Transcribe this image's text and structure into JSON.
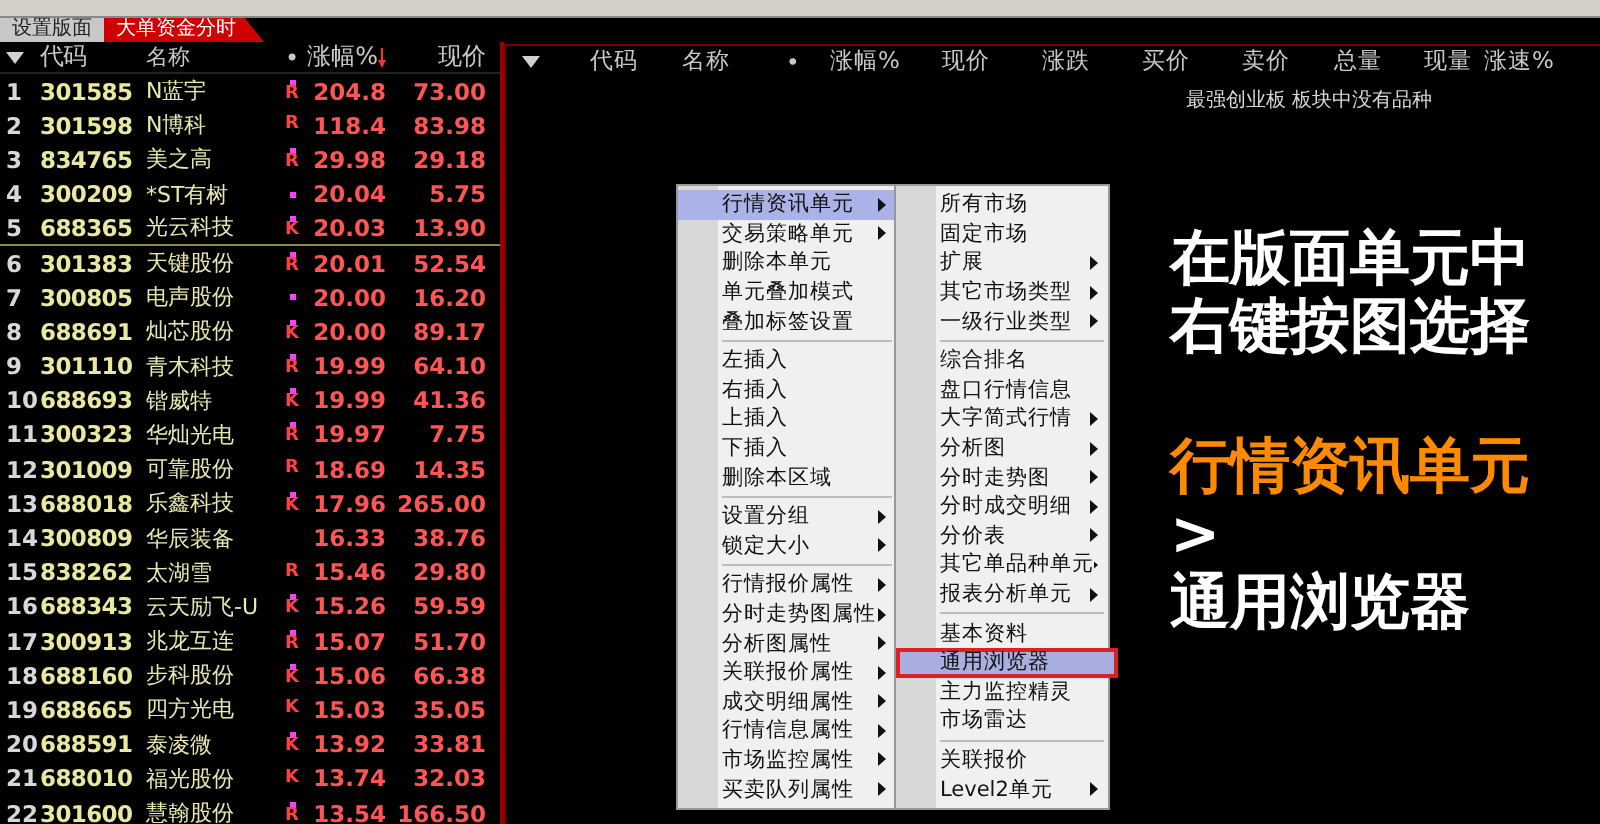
{
  "top_tabs": [
    {
      "label": "设置版面",
      "selected": false
    },
    {
      "label": "大单资金分时",
      "selected": true
    }
  ],
  "left_table": {
    "columns": [
      {
        "label": "代码",
        "sorted": false
      },
      {
        "label": "名称",
        "sorted": false
      },
      {
        "label": "•",
        "sorted": false
      },
      {
        "label": "涨幅%",
        "sorted": true
      },
      {
        "label": "现价",
        "sorted": false
      }
    ],
    "rows": [
      {
        "no": "1",
        "code": "301585",
        "name": "N蓝宇",
        "flag": true,
        "tag": "R",
        "change": "204.8",
        "price": "73.00",
        "separator_below": false
      },
      {
        "no": "2",
        "code": "301598",
        "name": "N博科",
        "flag": false,
        "tag": "R",
        "change": "118.4",
        "price": "83.98",
        "separator_below": false
      },
      {
        "no": "3",
        "code": "834765",
        "name": "美之高",
        "flag": true,
        "tag": "R",
        "change": "29.98",
        "price": "29.18",
        "separator_below": false
      },
      {
        "no": "4",
        "code": "300209",
        "name": "*ST有树",
        "flag": true,
        "tag": "",
        "change": "20.04",
        "price": "5.75",
        "separator_below": false
      },
      {
        "no": "5",
        "code": "688365",
        "name": "光云科技",
        "flag": true,
        "tag": "K",
        "change": "20.03",
        "price": "13.90",
        "separator_below": true
      },
      {
        "no": "6",
        "code": "301383",
        "name": "天键股份",
        "flag": true,
        "tag": "R",
        "change": "20.01",
        "price": "52.54",
        "separator_below": false
      },
      {
        "no": "7",
        "code": "300805",
        "name": "电声股份",
        "flag": true,
        "tag": "",
        "change": "20.00",
        "price": "16.20",
        "separator_below": false
      },
      {
        "no": "8",
        "code": "688691",
        "name": "灿芯股份",
        "flag": true,
        "tag": "K",
        "change": "20.00",
        "price": "89.17",
        "separator_below": false
      },
      {
        "no": "9",
        "code": "301110",
        "name": "青木科技",
        "flag": true,
        "tag": "R",
        "change": "19.99",
        "price": "64.10",
        "separator_below": false
      },
      {
        "no": "10",
        "code": "688693",
        "name": "锴威特",
        "flag": true,
        "tag": "K",
        "change": "19.99",
        "price": "41.36",
        "separator_below": false
      },
      {
        "no": "11",
        "code": "300323",
        "name": "华灿光电",
        "flag": true,
        "tag": "R",
        "change": "19.97",
        "price": "7.75",
        "separator_below": false
      },
      {
        "no": "12",
        "code": "301009",
        "name": "可靠股份",
        "flag": false,
        "tag": "R",
        "change": "18.69",
        "price": "14.35",
        "separator_below": false
      },
      {
        "no": "13",
        "code": "688018",
        "name": "乐鑫科技",
        "flag": true,
        "tag": "K",
        "change": "17.96",
        "price": "265.00",
        "separator_below": false
      },
      {
        "no": "14",
        "code": "300809",
        "name": "华辰装备",
        "flag": false,
        "tag": "",
        "change": "16.33",
        "price": "38.76",
        "separator_below": false
      },
      {
        "no": "15",
        "code": "838262",
        "name": "太湖雪",
        "flag": false,
        "tag": "R",
        "change": "15.46",
        "price": "29.80",
        "separator_below": false
      },
      {
        "no": "16",
        "code": "688343",
        "name": "云天励飞-U",
        "flag": true,
        "tag": "K",
        "change": "15.26",
        "price": "59.59",
        "separator_below": false
      },
      {
        "no": "17",
        "code": "300913",
        "name": "兆龙互连",
        "flag": true,
        "tag": "R",
        "change": "15.07",
        "price": "51.70",
        "separator_below": false
      },
      {
        "no": "18",
        "code": "688160",
        "name": "步科股份",
        "flag": true,
        "tag": "K",
        "change": "15.06",
        "price": "66.38",
        "separator_below": false
      },
      {
        "no": "19",
        "code": "688665",
        "name": "四方光电",
        "flag": false,
        "tag": "K",
        "change": "15.03",
        "price": "35.05",
        "separator_below": false
      },
      {
        "no": "20",
        "code": "688591",
        "name": "泰凌微",
        "flag": true,
        "tag": "K",
        "change": "13.92",
        "price": "33.81",
        "separator_below": false
      },
      {
        "no": "21",
        "code": "688010",
        "name": "福光股份",
        "flag": false,
        "tag": "K",
        "change": "13.74",
        "price": "32.03",
        "separator_below": false
      },
      {
        "no": "22",
        "code": "301600",
        "name": "慧翰股份",
        "flag": true,
        "tag": "R",
        "change": "13.54",
        "price": "166.50",
        "separator_below": false
      }
    ]
  },
  "right_table": {
    "columns": [
      {
        "label": "代码"
      },
      {
        "label": "名称"
      },
      {
        "label": "•"
      },
      {
        "label": "涨幅%"
      },
      {
        "label": "现价"
      },
      {
        "label": "涨跌"
      },
      {
        "label": "买价"
      },
      {
        "label": "卖价"
      },
      {
        "label": "总量"
      },
      {
        "label": "现量"
      },
      {
        "label": "涨速%"
      }
    ],
    "message": "最强创业板 板块中没有品种"
  },
  "annotation": [
    {
      "text": "在版面单元中",
      "color": "#ffffff"
    },
    {
      "text": "右键按图选择",
      "color": "#ffffff"
    },
    {
      "text": "行情资讯单元",
      "color": "#ff8a00"
    },
    {
      "text": ">",
      "color": "#ffffff"
    },
    {
      "text": "通用浏览器",
      "color": "#ffffff"
    }
  ],
  "context_menu": {
    "items": [
      {
        "kind": "item",
        "label": "行情资讯单元",
        "has_submenu": true,
        "selected": true
      },
      {
        "kind": "item",
        "label": "交易策略单元",
        "has_submenu": true,
        "selected": false
      },
      {
        "kind": "item",
        "label": "删除本单元",
        "has_submenu": false,
        "selected": false
      },
      {
        "kind": "item",
        "label": "单元叠加模式",
        "has_submenu": false,
        "selected": false
      },
      {
        "kind": "item",
        "label": "叠加标签设置",
        "has_submenu": false,
        "selected": false
      },
      {
        "kind": "separator"
      },
      {
        "kind": "item",
        "label": "左插入",
        "has_submenu": false,
        "selected": false
      },
      {
        "kind": "item",
        "label": "右插入",
        "has_submenu": false,
        "selected": false
      },
      {
        "kind": "item",
        "label": "上插入",
        "has_submenu": false,
        "selected": false
      },
      {
        "kind": "item",
        "label": "下插入",
        "has_submenu": false,
        "selected": false
      },
      {
        "kind": "item",
        "label": "删除本区域",
        "has_submenu": false,
        "selected": false
      },
      {
        "kind": "separator"
      },
      {
        "kind": "item",
        "label": "设置分组",
        "has_submenu": true,
        "selected": false
      },
      {
        "kind": "item",
        "label": "锁定大小",
        "has_submenu": true,
        "selected": false
      },
      {
        "kind": "separator"
      },
      {
        "kind": "item",
        "label": "行情报价属性",
        "has_submenu": true,
        "selected": false
      },
      {
        "kind": "item",
        "label": "分时走势图属性",
        "has_submenu": true,
        "selected": false
      },
      {
        "kind": "item",
        "label": "分析图属性",
        "has_submenu": true,
        "selected": false
      },
      {
        "kind": "item",
        "label": "关联报价属性",
        "has_submenu": true,
        "selected": false
      },
      {
        "kind": "item",
        "label": "成交明细属性",
        "has_submenu": true,
        "selected": false
      },
      {
        "kind": "item",
        "label": "行情信息属性",
        "has_submenu": true,
        "selected": false
      },
      {
        "kind": "item",
        "label": "市场监控属性",
        "has_submenu": true,
        "selected": false
      },
      {
        "kind": "item",
        "label": "买卖队列属性",
        "has_submenu": true,
        "selected": false
      }
    ]
  },
  "submenu": {
    "items": [
      {
        "kind": "item",
        "label": "所有市场",
        "has_submenu": false,
        "selected": false
      },
      {
        "kind": "item",
        "label": "固定市场",
        "has_submenu": false,
        "selected": false
      },
      {
        "kind": "item",
        "label": "扩展",
        "has_submenu": true,
        "selected": false
      },
      {
        "kind": "item",
        "label": "其它市场类型",
        "has_submenu": true,
        "selected": false
      },
      {
        "kind": "item",
        "label": "一级行业类型",
        "has_submenu": true,
        "selected": false
      },
      {
        "kind": "separator"
      },
      {
        "kind": "item",
        "label": "综合排名",
        "has_submenu": false,
        "selected": false
      },
      {
        "kind": "item",
        "label": "盘口行情信息",
        "has_submenu": false,
        "selected": false
      },
      {
        "kind": "item",
        "label": "大字简式行情",
        "has_submenu": true,
        "selected": false
      },
      {
        "kind": "item",
        "label": "分析图",
        "has_submenu": true,
        "selected": false
      },
      {
        "kind": "item",
        "label": "分时走势图",
        "has_submenu": true,
        "selected": false
      },
      {
        "kind": "item",
        "label": "分时成交明细",
        "has_submenu": true,
        "selected": false
      },
      {
        "kind": "item",
        "label": "分价表",
        "has_submenu": true,
        "selected": false
      },
      {
        "kind": "item",
        "label": "其它单品种单元",
        "has_submenu": true,
        "selected": false
      },
      {
        "kind": "item",
        "label": "报表分析单元",
        "has_submenu": true,
        "selected": false
      },
      {
        "kind": "separator"
      },
      {
        "kind": "item",
        "label": "基本资料",
        "has_submenu": false,
        "selected": false
      },
      {
        "kind": "item",
        "label": "通用浏览器",
        "has_submenu": false,
        "selected": true
      },
      {
        "kind": "item",
        "label": "主力监控精灵",
        "has_submenu": false,
        "selected": false
      },
      {
        "kind": "item",
        "label": "市场雷达",
        "has_submenu": false,
        "selected": false
      },
      {
        "kind": "separator"
      },
      {
        "kind": "item",
        "label": "关联报价",
        "has_submenu": false,
        "selected": false
      },
      {
        "kind": "item",
        "label": "Level2单元",
        "has_submenu": true,
        "selected": false
      }
    ]
  }
}
